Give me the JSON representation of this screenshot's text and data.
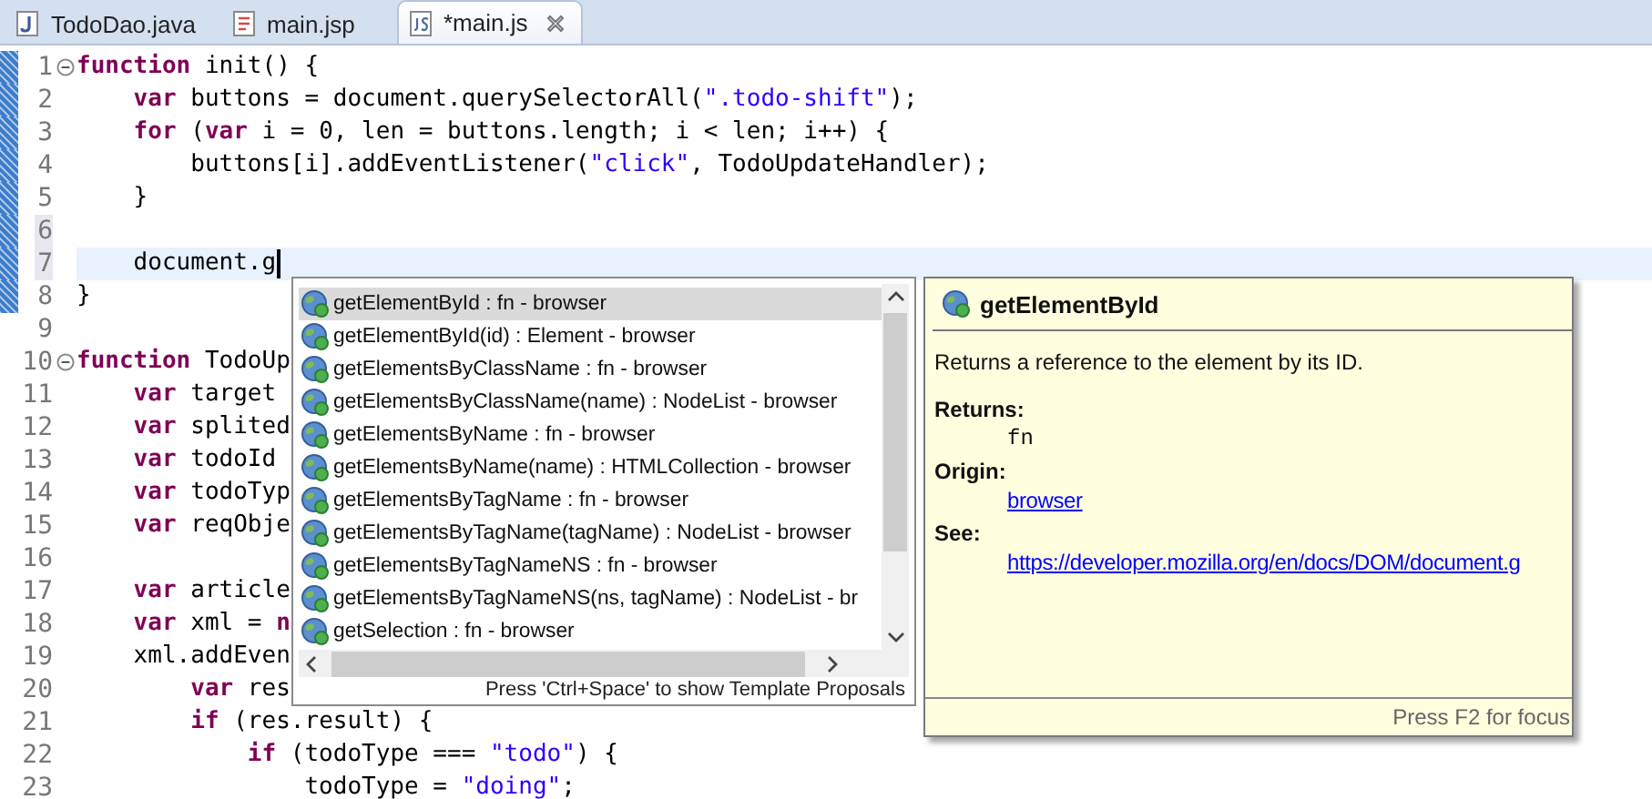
{
  "tabs": [
    {
      "label": "TodoDao.java",
      "kind": "java",
      "selected": false
    },
    {
      "label": "main.jsp",
      "kind": "jsp",
      "selected": false
    },
    {
      "label": "*main.js",
      "kind": "js",
      "selected": true
    }
  ],
  "editor": {
    "lines": [
      {
        "number": "1",
        "foldable": true,
        "changed": true,
        "highlighted": false,
        "current": false,
        "caret": false,
        "tokens": [
          {
            "kind": "keyword",
            "text": "function"
          },
          {
            "kind": "plain",
            "text": " init() {"
          }
        ]
      },
      {
        "number": "2",
        "foldable": false,
        "changed": true,
        "highlighted": false,
        "current": false,
        "caret": false,
        "tokens": [
          {
            "kind": "keyword",
            "text": "    var"
          },
          {
            "kind": "plain",
            "text": " buttons = document.querySelectorAll("
          },
          {
            "kind": "string",
            "text": "\".todo-shift\""
          },
          {
            "kind": "plain",
            "text": ");"
          }
        ]
      },
      {
        "number": "3",
        "foldable": false,
        "changed": true,
        "highlighted": false,
        "current": false,
        "caret": false,
        "tokens": [
          {
            "kind": "keyword",
            "text": "    for"
          },
          {
            "kind": "plain",
            "text": " ("
          },
          {
            "kind": "keyword",
            "text": "var"
          },
          {
            "kind": "plain",
            "text": " i = 0, len = buttons.length; i < len; i++) {"
          }
        ]
      },
      {
        "number": "4",
        "foldable": false,
        "changed": true,
        "highlighted": false,
        "current": false,
        "caret": false,
        "tokens": [
          {
            "kind": "plain",
            "text": "        buttons[i].addEventListener("
          },
          {
            "kind": "string",
            "text": "\"click\""
          },
          {
            "kind": "plain",
            "text": ", TodoUpdateHandler);"
          }
        ]
      },
      {
        "number": "5",
        "foldable": false,
        "changed": true,
        "highlighted": false,
        "current": false,
        "caret": false,
        "tokens": [
          {
            "kind": "plain",
            "text": "    }"
          }
        ]
      },
      {
        "number": "6",
        "foldable": false,
        "changed": true,
        "highlighted": true,
        "current": false,
        "caret": false
      },
      {
        "number": "7",
        "foldable": false,
        "changed": true,
        "highlighted": true,
        "current": true,
        "caret": true,
        "tokens": [
          {
            "kind": "plain",
            "text": "    document.g"
          }
        ]
      },
      {
        "number": "8",
        "foldable": false,
        "changed": true,
        "highlighted": false,
        "current": false,
        "caret": false,
        "tokens": [
          {
            "kind": "plain",
            "text": "}"
          }
        ]
      },
      {
        "number": "9",
        "foldable": false,
        "changed": false,
        "highlighted": false,
        "current": false,
        "caret": false
      },
      {
        "number": "10",
        "foldable": true,
        "changed": false,
        "highlighted": false,
        "current": false,
        "caret": false,
        "tokens": [
          {
            "kind": "keyword",
            "text": "function"
          },
          {
            "kind": "plain",
            "text": " TodoUp"
          }
        ]
      },
      {
        "number": "11",
        "foldable": false,
        "changed": false,
        "highlighted": false,
        "current": false,
        "caret": false,
        "tokens": [
          {
            "kind": "keyword",
            "text": "    var"
          },
          {
            "kind": "plain",
            "text": " target"
          }
        ]
      },
      {
        "number": "12",
        "foldable": false,
        "changed": false,
        "highlighted": false,
        "current": false,
        "caret": false,
        "tokens": [
          {
            "kind": "keyword",
            "text": "    var"
          },
          {
            "kind": "plain",
            "text": " splited"
          }
        ]
      },
      {
        "number": "13",
        "foldable": false,
        "changed": false,
        "highlighted": false,
        "current": false,
        "caret": false,
        "tokens": [
          {
            "kind": "keyword",
            "text": "    var"
          },
          {
            "kind": "plain",
            "text": " todoId"
          }
        ]
      },
      {
        "number": "14",
        "foldable": false,
        "changed": false,
        "highlighted": false,
        "current": false,
        "caret": false,
        "tokens": [
          {
            "kind": "keyword",
            "text": "    var"
          },
          {
            "kind": "plain",
            "text": " todoTyp"
          }
        ]
      },
      {
        "number": "15",
        "foldable": false,
        "changed": false,
        "highlighted": false,
        "current": false,
        "caret": false,
        "tokens": [
          {
            "kind": "keyword",
            "text": "    var"
          },
          {
            "kind": "plain",
            "text": " reqObje"
          }
        ]
      },
      {
        "number": "16",
        "foldable": false,
        "changed": false,
        "highlighted": false,
        "current": false,
        "caret": false
      },
      {
        "number": "17",
        "foldable": false,
        "changed": false,
        "highlighted": false,
        "current": false,
        "caret": false,
        "tokens": [
          {
            "kind": "keyword",
            "text": "    var"
          },
          {
            "kind": "plain",
            "text": " article"
          }
        ]
      },
      {
        "number": "18",
        "foldable": false,
        "changed": false,
        "highlighted": false,
        "current": false,
        "caret": false,
        "tokens": [
          {
            "kind": "keyword",
            "text": "    var"
          },
          {
            "kind": "plain",
            "text": " xml = "
          },
          {
            "kind": "keyword",
            "text": "n"
          }
        ]
      },
      {
        "number": "19",
        "foldable": false,
        "changed": false,
        "highlighted": false,
        "current": false,
        "caret": false,
        "tokens": [
          {
            "kind": "plain",
            "text": "    xml.addEven"
          }
        ]
      },
      {
        "number": "20",
        "foldable": false,
        "changed": false,
        "highlighted": false,
        "current": false,
        "caret": false,
        "tokens": [
          {
            "kind": "keyword",
            "text": "        var"
          },
          {
            "kind": "plain",
            "text": " res"
          }
        ]
      },
      {
        "number": "21",
        "foldable": false,
        "changed": false,
        "highlighted": false,
        "current": false,
        "caret": false,
        "tokens": [
          {
            "kind": "keyword",
            "text": "        if"
          },
          {
            "kind": "plain",
            "text": " (res.result) {"
          }
        ]
      },
      {
        "number": "22",
        "foldable": false,
        "changed": false,
        "highlighted": false,
        "current": false,
        "caret": false,
        "tokens": [
          {
            "kind": "keyword",
            "text": "            if"
          },
          {
            "kind": "plain",
            "text": " (todoType === "
          },
          {
            "kind": "string",
            "text": "\"todo\""
          },
          {
            "kind": "plain",
            "text": ") {"
          }
        ]
      },
      {
        "number": "23",
        "foldable": false,
        "changed": false,
        "highlighted": false,
        "current": false,
        "caret": false,
        "tokens": [
          {
            "kind": "plain",
            "text": "                todoType = "
          },
          {
            "kind": "string",
            "text": "\"doing\""
          },
          {
            "kind": "plain",
            "text": ";"
          }
        ]
      }
    ]
  },
  "completion": {
    "items": [
      {
        "text": "getElementById : fn - browser",
        "selected": true
      },
      {
        "text": "getElementById(id) : Element - browser",
        "selected": false
      },
      {
        "text": "getElementsByClassName : fn - browser",
        "selected": false
      },
      {
        "text": "getElementsByClassName(name) : NodeList - browser",
        "selected": false
      },
      {
        "text": "getElementsByName : fn - browser",
        "selected": false
      },
      {
        "text": "getElementsByName(name) : HTMLCollection - browser",
        "selected": false
      },
      {
        "text": "getElementsByTagName : fn - browser",
        "selected": false
      },
      {
        "text": "getElementsByTagName(tagName) : NodeList - browser",
        "selected": false
      },
      {
        "text": "getElementsByTagNameNS : fn - browser",
        "selected": false
      },
      {
        "text": "getElementsByTagNameNS(ns, tagName) : NodeList - br",
        "selected": false
      },
      {
        "text": "getSelection : fn - browser",
        "selected": false
      }
    ],
    "hint": "Press 'Ctrl+Space' to show Template Proposals"
  },
  "info": {
    "title": "getElementById",
    "description": "Returns a reference to the element by its ID.",
    "sections": [
      {
        "label": "Returns:",
        "kind": "code",
        "value": "fn"
      },
      {
        "label": "Origin:",
        "kind": "link",
        "value": "browser"
      },
      {
        "label": "See:",
        "kind": "link",
        "value": "https://developer.mozilla.org/en/docs/DOM/document.g"
      }
    ],
    "footer": "Press F2 for focus"
  }
}
